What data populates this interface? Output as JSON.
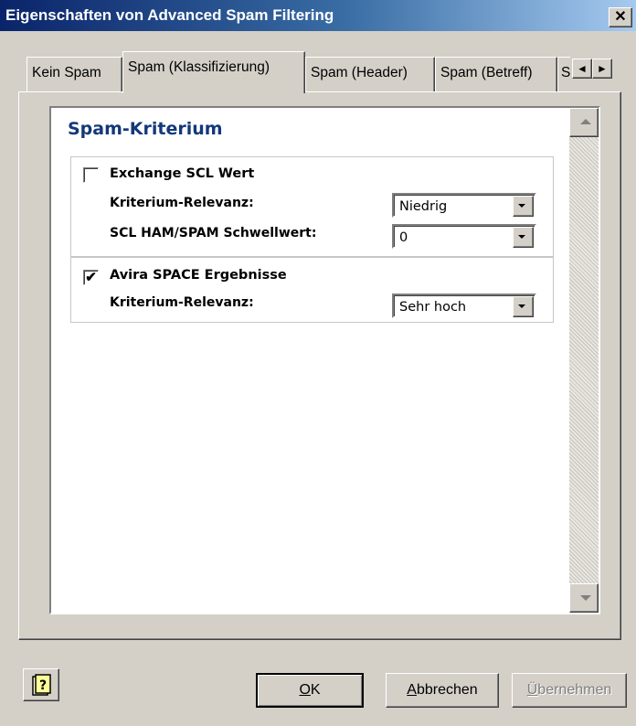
{
  "window": {
    "title": "Eigenschaften von Advanced Spam Filtering",
    "close_label": "✕"
  },
  "tabs": [
    {
      "label": "Kein Spam",
      "active": false
    },
    {
      "label": "Spam (Klassifizierung)",
      "active": true
    },
    {
      "label": "Spam (Header)",
      "active": false
    },
    {
      "label": "Spam (Betreff)",
      "active": false
    },
    {
      "label": "S",
      "active": false
    }
  ],
  "tab_scroll": {
    "left": "◄",
    "right": "►"
  },
  "panel": {
    "section_title": "Spam-Kriterium",
    "groups": [
      {
        "checkbox_label": "Exchange SCL Wert",
        "checked": false,
        "check_mark": "",
        "fields": [
          {
            "label": "Kriterium-Relevanz:",
            "value": "Niedrig"
          },
          {
            "label": "SCL HAM/SPAM Schwellwert:",
            "value": "0"
          }
        ]
      },
      {
        "checkbox_label": "Avira SPACE Ergebnisse",
        "checked": true,
        "check_mark": "✔",
        "fields": [
          {
            "label": "Kriterium-Relevanz:",
            "value": "Sehr hoch"
          }
        ]
      }
    ]
  },
  "buttons": {
    "help_icon": "help-book-icon",
    "ok_prefix": "",
    "ok_underline": "O",
    "ok_rest": "K",
    "cancel_underline": "A",
    "cancel_rest": "bbrechen",
    "apply_underline": "Ü",
    "apply_rest": "bernehmen"
  },
  "colors": {
    "title_gradient_start": "#0a246a",
    "section_title": "#13387a",
    "dialog_bg": "#d4d0c8"
  }
}
